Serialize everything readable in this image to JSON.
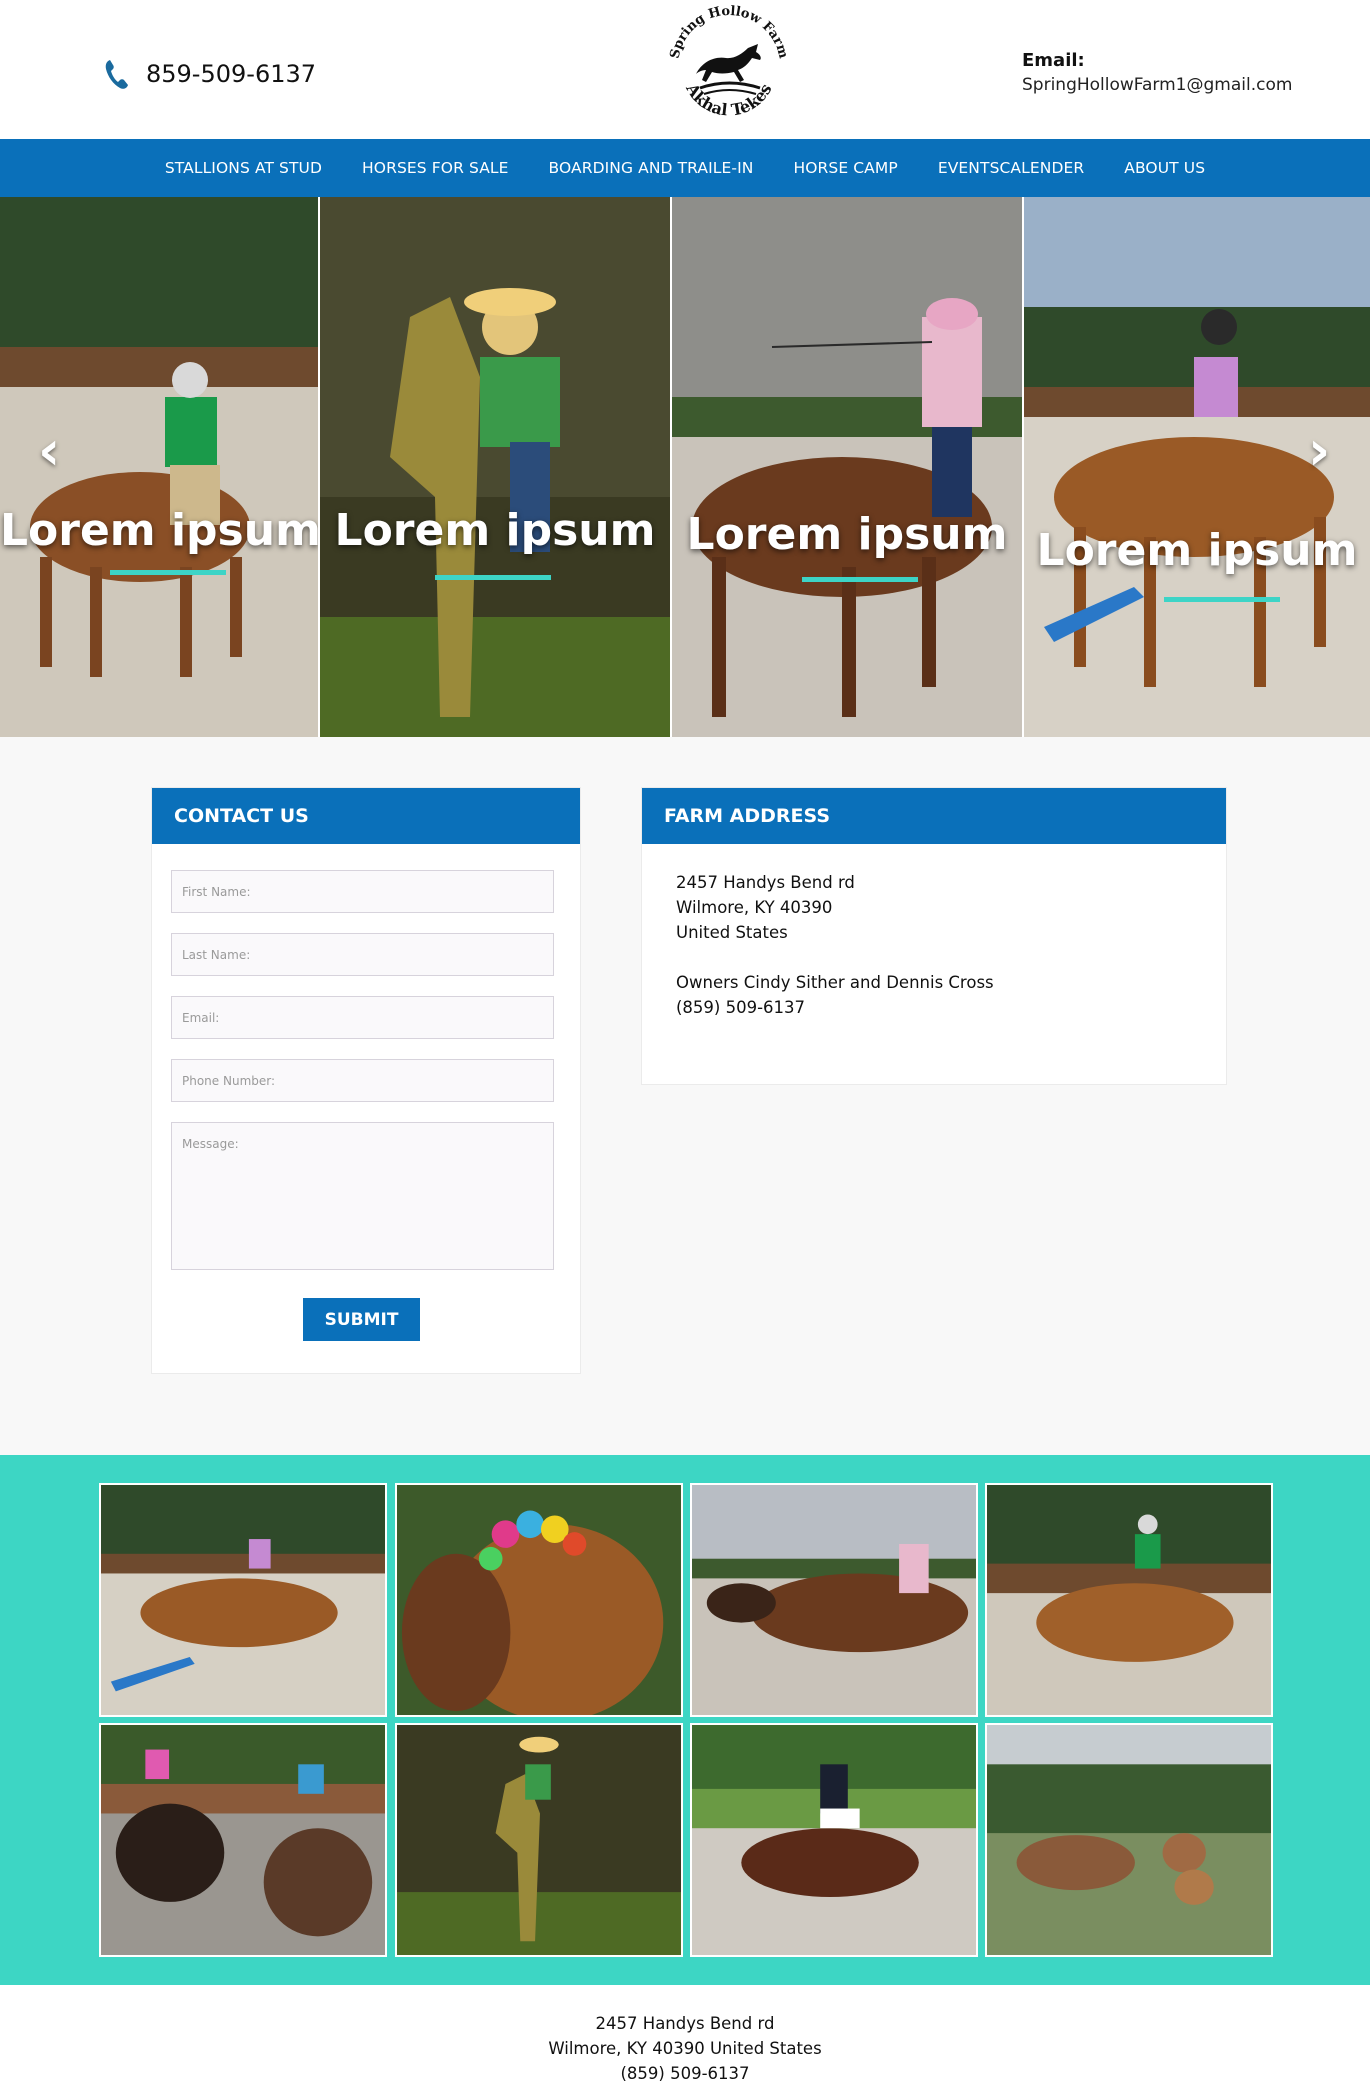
{
  "header": {
    "phone": "859-509-6137",
    "logo_text_top": "Spring Hollow Farm",
    "logo_text_bottom": "Akhal Tekes",
    "email_label": "Email:",
    "email_value": "SpringHollowFarm1@gmail.com"
  },
  "nav": {
    "items": [
      "STALLIONS AT STUD",
      "HORSES FOR SALE",
      "BOARDING AND TRAILE-IN",
      "HORSE CAMP",
      "EVENTSCALENDER",
      "ABOUT US"
    ]
  },
  "hero": {
    "captions": [
      "Lorem ipsum",
      "Lorem ipsum",
      "Lorem ipsum",
      "Lorem ipsum"
    ],
    "prev_icon": "chevron-left-icon",
    "next_icon": "chevron-right-icon",
    "accent_color": "#3dd4c6"
  },
  "contact": {
    "title": "CONTACT US",
    "first_name_placeholder": "First Name:",
    "last_name_placeholder": "Last Name:",
    "email_placeholder": "Email:",
    "phone_placeholder": "Phone Number:",
    "message_placeholder": "Message:",
    "submit_label": "SUBMIT"
  },
  "address": {
    "title": "FARM ADDRESS",
    "line1": "2457 Handys Bend rd",
    "line2": "Wilmore, KY 40390",
    "line3": "United States",
    "owners": "Owners Cindy Sither and Dennis Cross",
    "phone": "(859) 509-6137"
  },
  "footer": {
    "line1": "2457 Handys Bend rd",
    "line2": "Wilmore, KY 40390 United States",
    "line3": "(859) 509-6137"
  },
  "colors": {
    "brand_blue": "#0a70ba",
    "teal": "#3dd6c4"
  }
}
